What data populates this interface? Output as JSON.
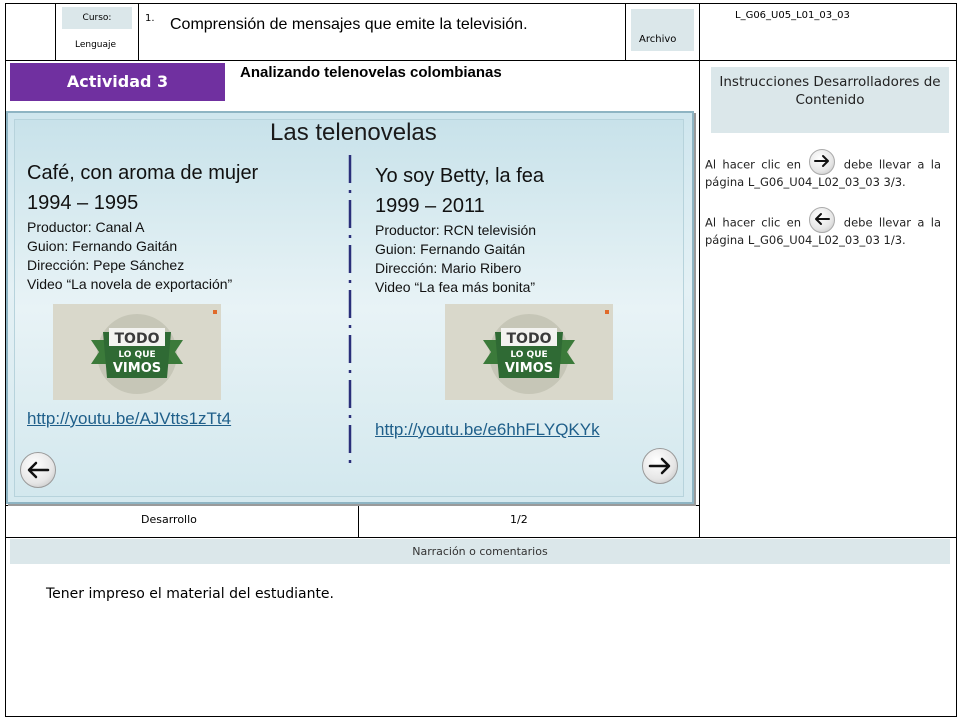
{
  "header": {
    "course_label": "Curso:",
    "course_value": "Lenguaje",
    "course_number": "1.",
    "title": "Comprensión de mensajes que emite la televisión.",
    "archivo_label": "Archivo",
    "code": "L_G06_U05_L01_03_03"
  },
  "activity": {
    "badge": "Actividad 3",
    "subtitle": "Analizando telenovelas colombianas"
  },
  "slide": {
    "title": "Las telenovelas",
    "left": {
      "title_line1": "Café, con aroma de mujer",
      "title_line2": "1994 – 1995",
      "producer": "Productor: Canal A",
      "writer": "Guion: Fernando Gaitán",
      "director": "Dirección: Pepe Sánchez",
      "video": "Video “La novela de exportación”",
      "link": "http://youtu.be/AJVtts1zTt4",
      "thumb_line1": "TODO",
      "thumb_line2": "LO QUE",
      "thumb_line3": "VIMOS"
    },
    "right": {
      "title_line1": "Yo soy Betty, la fea",
      "title_line2": "1999 – 2011",
      "producer": "Productor: RCN televisión",
      "writer": "Guion: Fernando Gaitán",
      "director": "Dirección: Mario Ribero",
      "video": "Video “La fea más bonita”",
      "link": "http://youtu.be/e6hhFLYQKYk",
      "thumb_line1": "TODO",
      "thumb_line2": "LO QUE",
      "thumb_line3": "VIMOS"
    },
    "prev_icon": "arrow-left-icon",
    "next_icon": "arrow-right-icon"
  },
  "footer_row": {
    "section": "Desarrollo",
    "page": "1/2"
  },
  "instructions": {
    "title": "Instrucciones Desarrolladores de Contenido",
    "note1_pre": "Al hacer clic en",
    "note1_post": "debe llevar a la página L_G06_U04_L02_03_03 3/3.",
    "note2_pre": "Al hacer clic en",
    "note2_post": "debe llevar a la página L_G06_U04_L02_03_03 1/3."
  },
  "narration": {
    "header": "Narración o comentarios",
    "text": "Tener impreso el material del estudiante."
  },
  "colors": {
    "badge": "#7030a0",
    "label_bg": "#dbe7ea",
    "divider": "#2a2f7a",
    "link": "#1f5f8a"
  }
}
